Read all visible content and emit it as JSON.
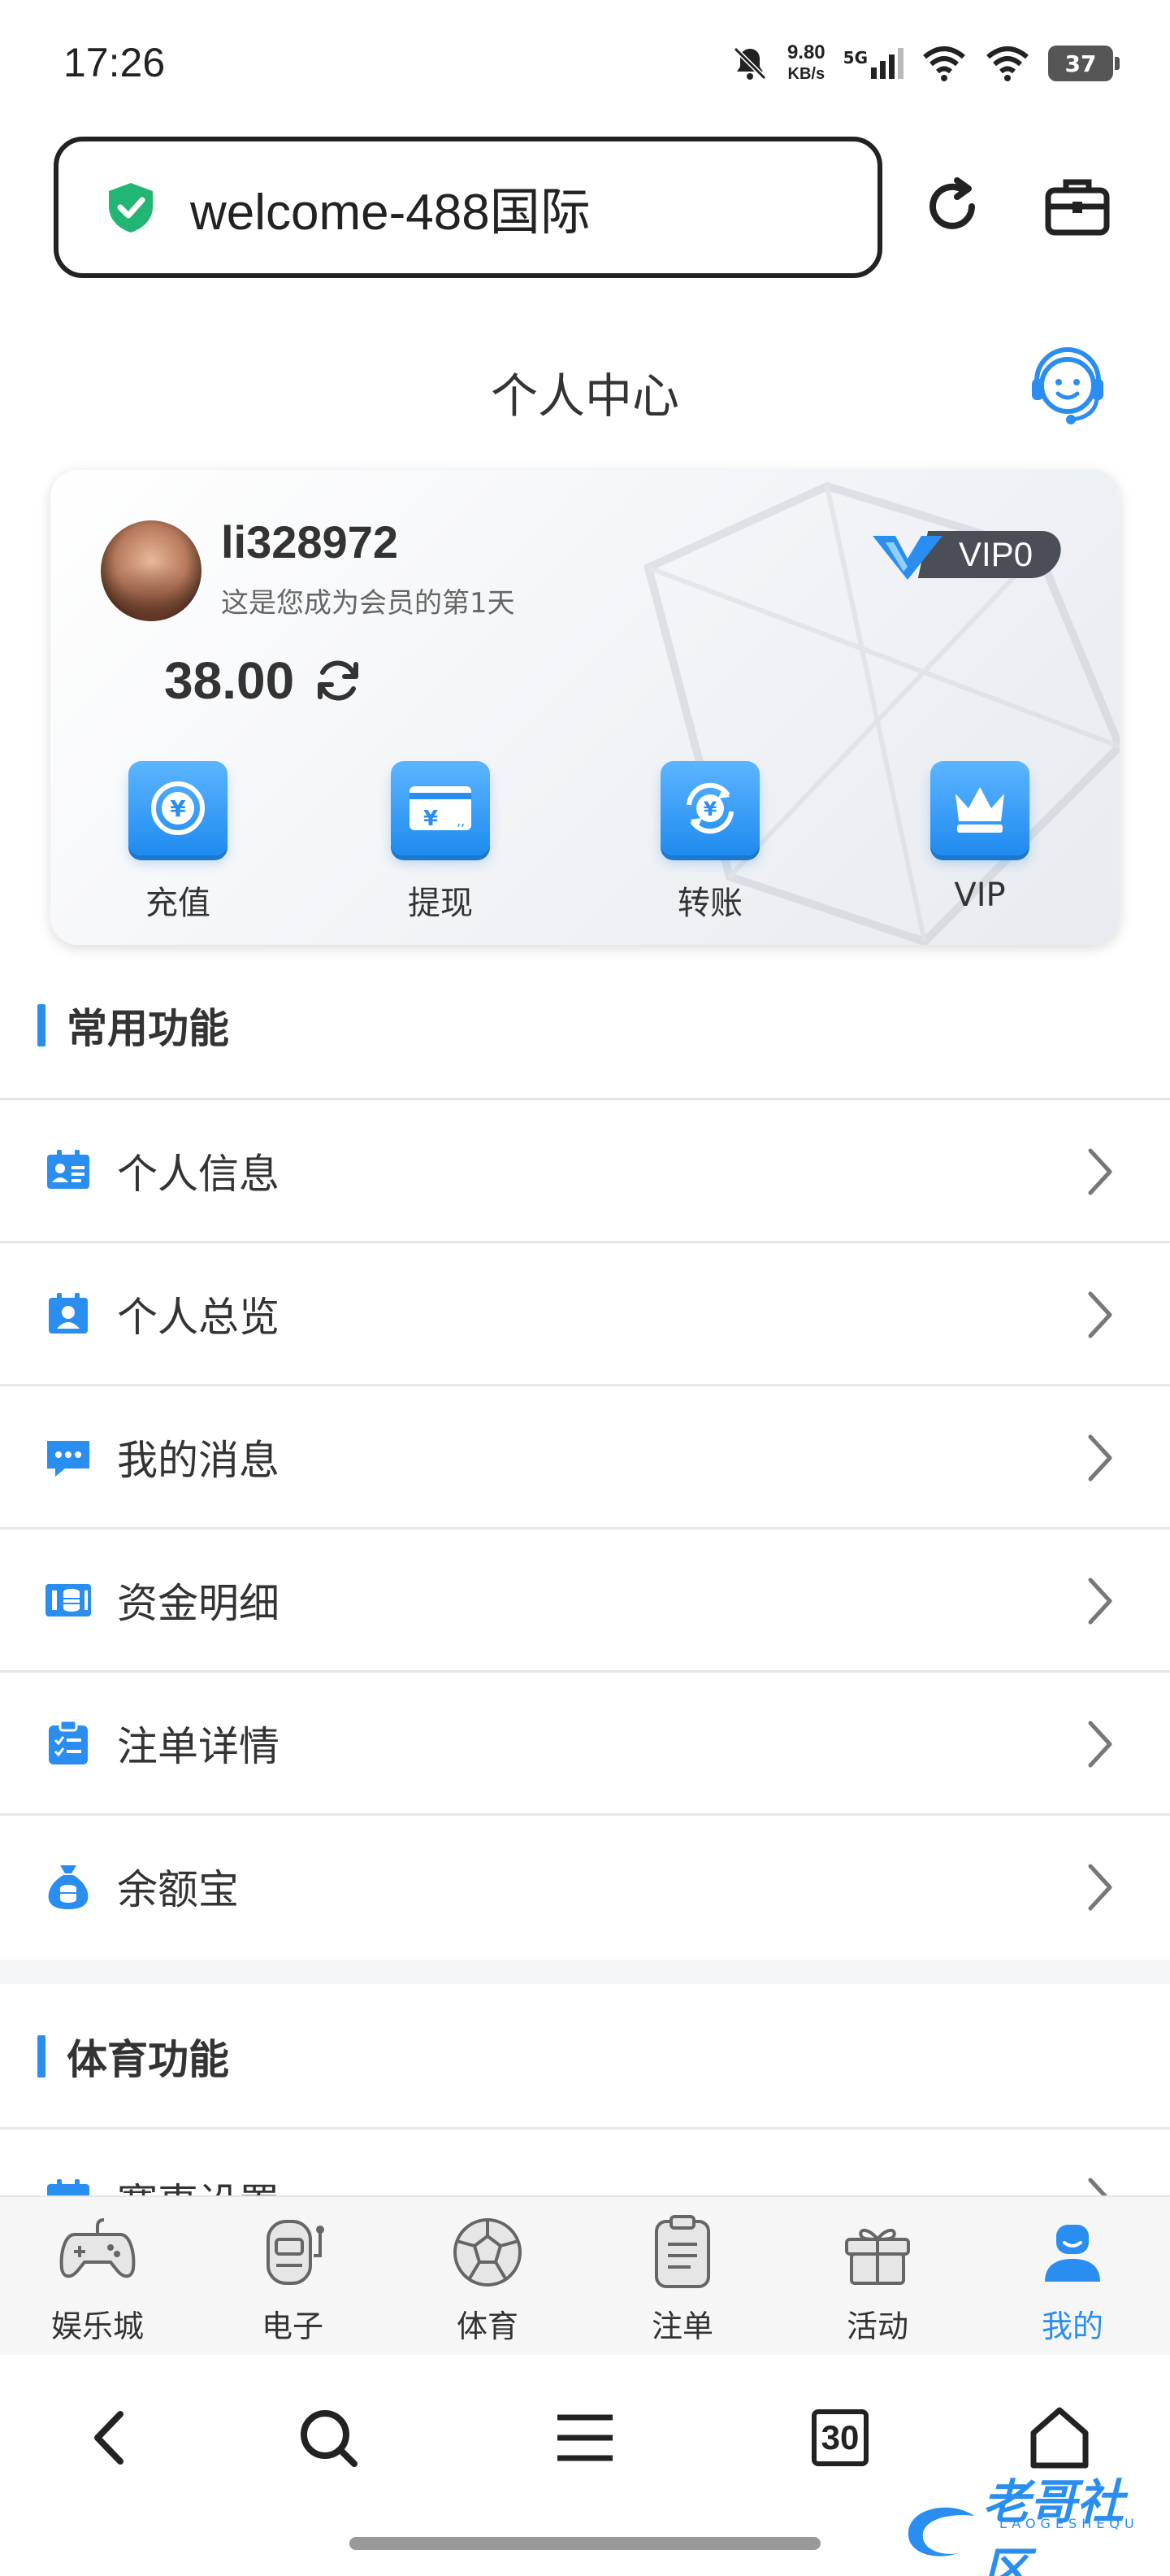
{
  "status_bar": {
    "time": "17:26",
    "net_speed_value": "9.80",
    "net_speed_unit": "KB/s",
    "network_type": "5G",
    "battery": "37"
  },
  "browser": {
    "url": "welcome-488国际"
  },
  "header": {
    "title": "个人中心"
  },
  "profile": {
    "username": "li328972",
    "member_days_text": "这是您成为会员的第1天",
    "vip_level": "VIP0",
    "balance": "38.00"
  },
  "quick_actions": [
    {
      "label": "充值",
      "icon": "recharge-icon"
    },
    {
      "label": "提现",
      "icon": "withdraw-icon"
    },
    {
      "label": "转账",
      "icon": "transfer-icon"
    },
    {
      "label": "VIP",
      "icon": "crown-icon"
    }
  ],
  "common_section": {
    "title": "常用功能",
    "items": [
      {
        "label": "个人信息",
        "icon": "id-card-icon"
      },
      {
        "label": "个人总览",
        "icon": "user-badge-icon"
      },
      {
        "label": "我的消息",
        "icon": "message-icon"
      },
      {
        "label": "资金明细",
        "icon": "funds-icon"
      },
      {
        "label": "注单详情",
        "icon": "clipboard-icon"
      },
      {
        "label": "余额宝",
        "icon": "money-bag-icon"
      }
    ]
  },
  "sports_section": {
    "title": "体育功能",
    "items": [
      {
        "label": "赛事设置",
        "icon": "calendar-icon"
      }
    ]
  },
  "tab_bar": [
    {
      "label": "娱乐城",
      "icon": "gamepad-icon"
    },
    {
      "label": "电子",
      "icon": "slot-machine-icon"
    },
    {
      "label": "体育",
      "icon": "football-icon"
    },
    {
      "label": "注单",
      "icon": "document-icon"
    },
    {
      "label": "活动",
      "icon": "gift-icon"
    },
    {
      "label": "我的",
      "icon": "profile-icon",
      "active": true
    }
  ],
  "browser_nav": {
    "tabs_count": "30"
  },
  "watermark": {
    "text": "老哥社区",
    "sub": "LAOGESHEQU"
  },
  "colors": {
    "accent": "#2a8ef0",
    "text": "#333333",
    "vip_pill": "#4a4f57"
  }
}
